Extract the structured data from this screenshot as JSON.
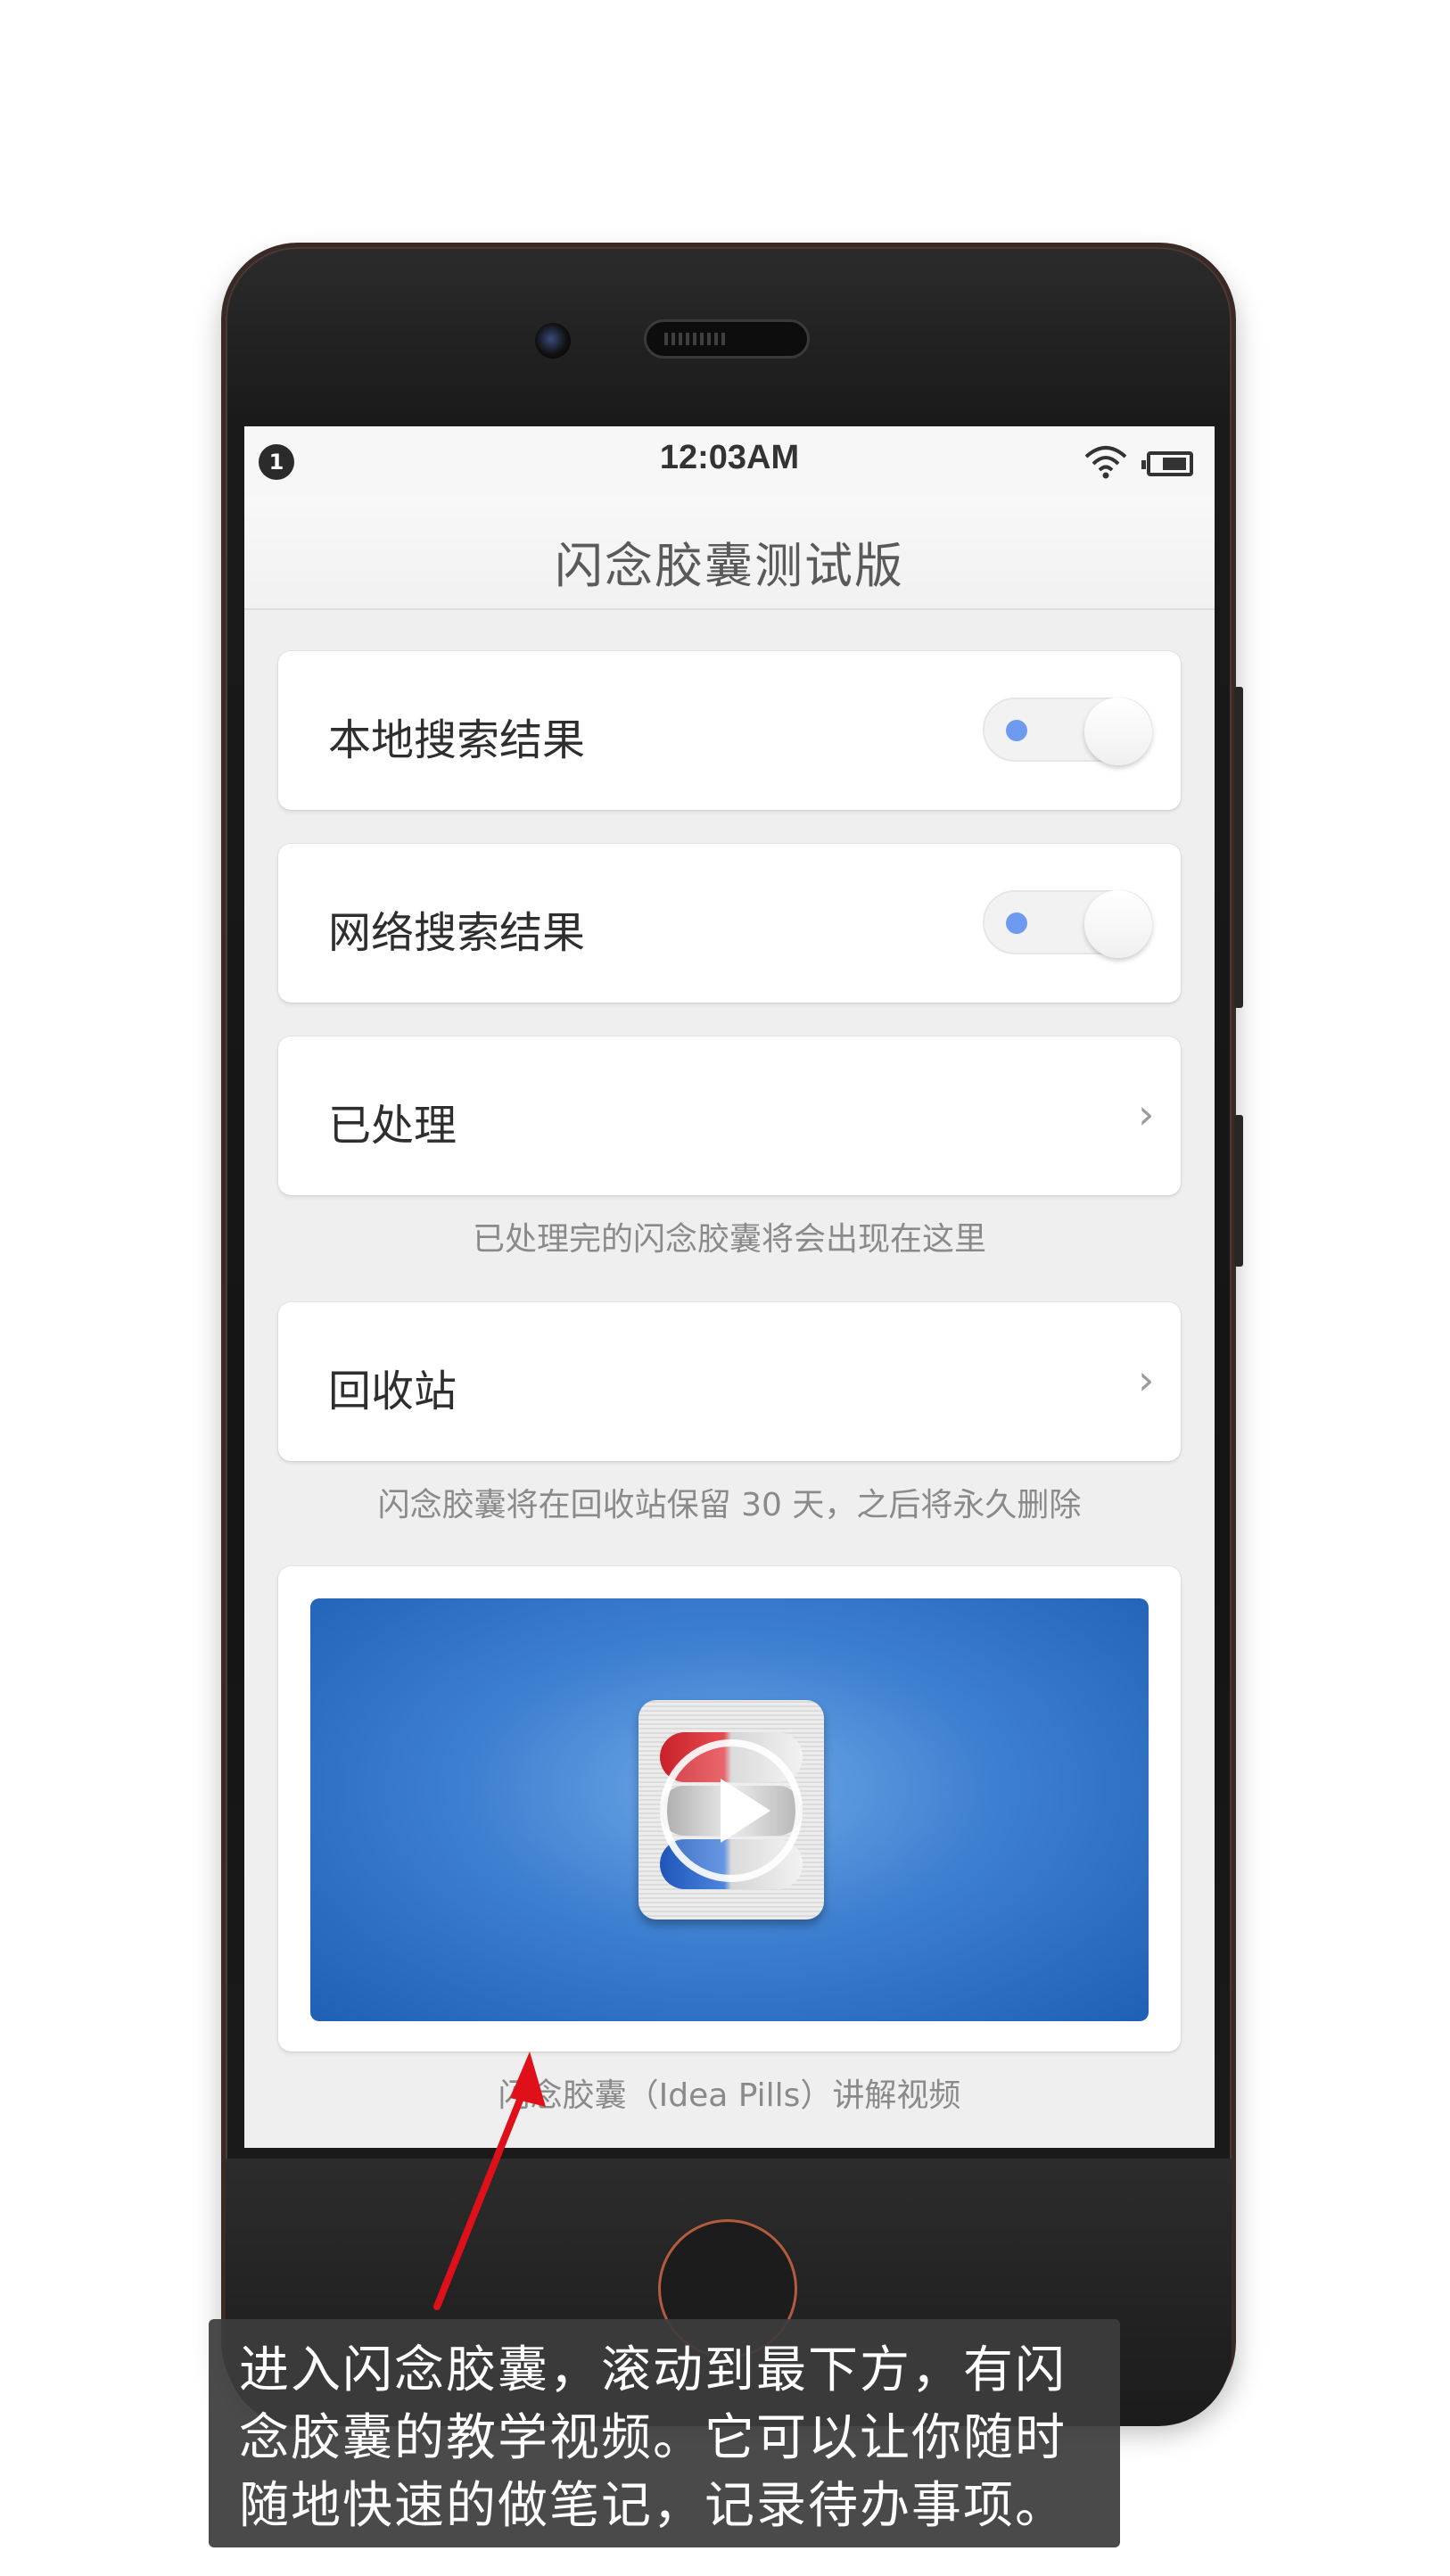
{
  "status_bar": {
    "notification_count": "1",
    "time": "12:03AM",
    "icons": [
      "wifi-icon",
      "battery-icon"
    ]
  },
  "app": {
    "title": "闪念胶囊测试版"
  },
  "settings": {
    "local_search": {
      "label": "本地搜索结果",
      "enabled": true
    },
    "web_search": {
      "label": "网络搜索结果",
      "enabled": true
    },
    "processed": {
      "label": "已处理",
      "caption": "已处理完的闪念胶囊将会出现在这里"
    },
    "recycle_bin": {
      "label": "回收站",
      "caption": "闪念胶囊将在回收站保留 30 天，之后将永久删除"
    }
  },
  "video": {
    "caption": "闪念胶囊（Idea Pills）讲解视频",
    "icon": "idea-pills-app-icon"
  },
  "annotation": {
    "text": "进入闪念胶囊，滚动到最下方，有闪念胶囊的教学视频。它可以让你随时随地快速的做笔记，记录待办事项。"
  },
  "colors": {
    "toggle_dot": "#6e9bf0",
    "arrow": "#e0101a",
    "video_blue": "#3d7fd0"
  }
}
